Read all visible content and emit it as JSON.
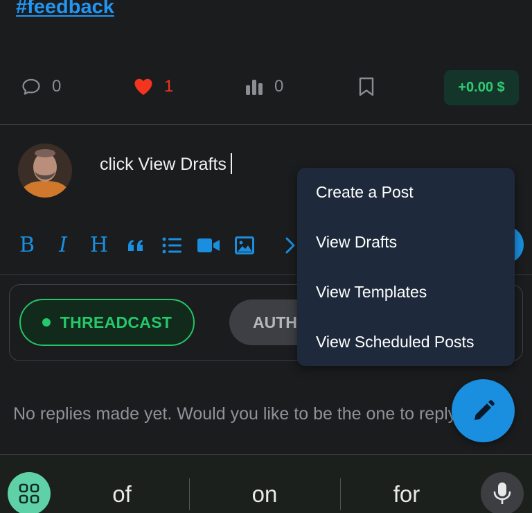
{
  "post": {
    "hashtag": "#feedback"
  },
  "stats": {
    "comments": "0",
    "likes": "1",
    "votes": "0",
    "payout": "+0.00 $"
  },
  "composer": {
    "text": "click View Drafts",
    "toolbar": [
      "bold",
      "italic",
      "heading",
      "quote",
      "list",
      "video",
      "image",
      "more"
    ]
  },
  "tabs": {
    "threadcast": "THREADCAST",
    "authors": "AUTH"
  },
  "menu": {
    "items": [
      "Create a Post",
      "View Drafts",
      "View Templates",
      "View Scheduled Posts"
    ]
  },
  "replies": {
    "empty_text": "No replies made yet. Would you like to be the one to reply?"
  },
  "keyboard": {
    "suggestions": [
      "of",
      "on",
      "for"
    ]
  },
  "colors": {
    "accent": "#1a8fe0",
    "like": "#f3341f",
    "success": "#25c86b",
    "menu_bg": "#1e2a3b"
  }
}
